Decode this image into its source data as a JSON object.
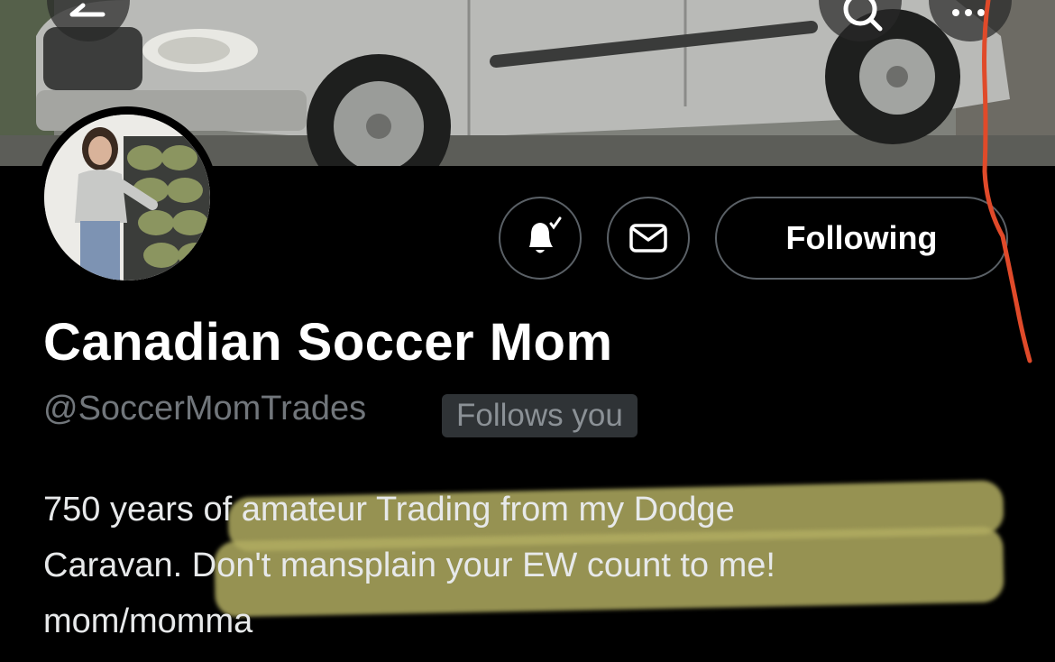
{
  "profile": {
    "display_name": "Canadian Soccer Mom",
    "handle": "@SoccerMomTrades",
    "follows_you_label": "Follows you",
    "bio": {
      "line1": "750 years of amateur Trading from my Dodge",
      "line2": "Caravan. Don't mansplain your EW count to me!",
      "line3": "mom/momma"
    }
  },
  "actions": {
    "following_label": "Following",
    "notify_icon": "bell-check-icon",
    "message_icon": "mail-icon"
  },
  "header_icons": {
    "back": "back-arrow-icon",
    "search": "search-icon",
    "more": "more-dots-icon"
  },
  "colors": {
    "background": "#000000",
    "text_primary": "#ffffff",
    "text_secondary": "#71767b",
    "badge_bg": "#2f3336",
    "border": "#5a6066",
    "annotation_red": "#e04a2a",
    "annotation_highlight": "#b0ac60"
  }
}
